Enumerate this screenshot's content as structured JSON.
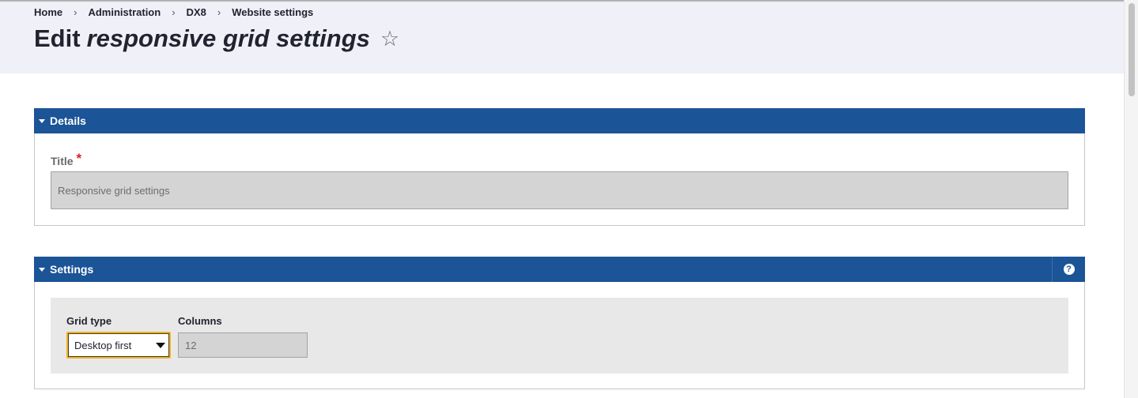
{
  "breadcrumb": [
    {
      "label": "Home"
    },
    {
      "label": "Administration"
    },
    {
      "label": "DX8"
    },
    {
      "label": "Website settings"
    }
  ],
  "separator": "›",
  "page": {
    "title_prefix": "Edit",
    "title_emphasis": "responsive grid settings",
    "favorite_icon": "☆"
  },
  "details": {
    "heading": "Details",
    "title_label": "Title",
    "required_mark": "*",
    "title_value": "Responsive grid settings"
  },
  "settings": {
    "heading": "Settings",
    "help_icon": "?",
    "grid_type_label": "Grid type",
    "grid_type_value": "Desktop first",
    "columns_label": "Columns",
    "columns_value": "12"
  },
  "colors": {
    "panel_header": "#1b5497",
    "header_bg": "#f0f0f8",
    "focus_outline": "#f2b21b",
    "required": "#d72222"
  }
}
